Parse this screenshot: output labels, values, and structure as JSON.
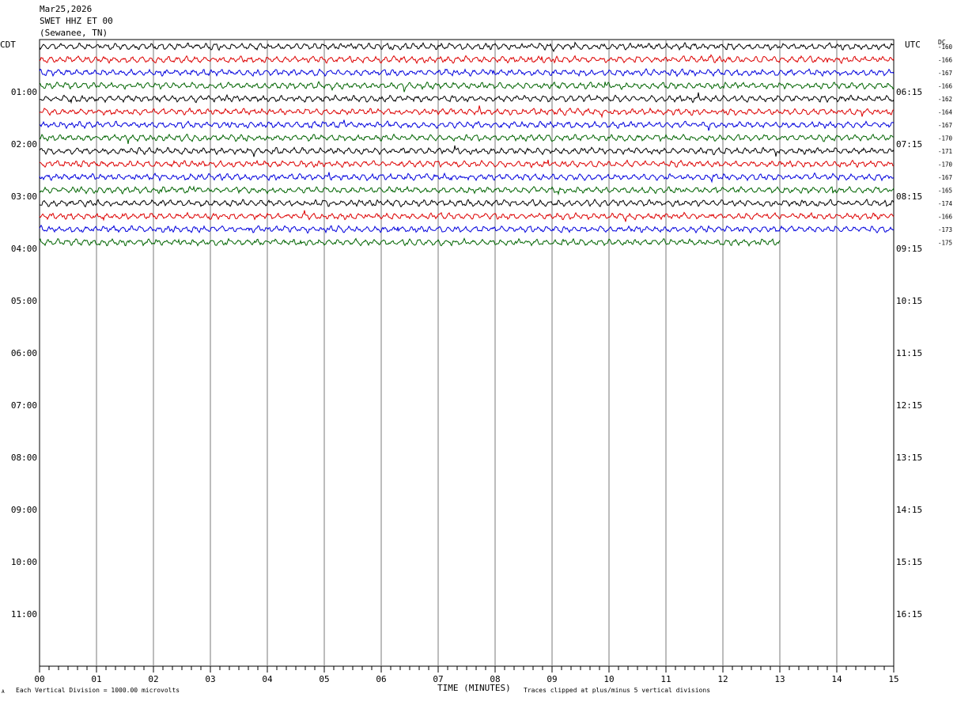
{
  "header": {
    "date": "Mar25,2026",
    "station": "SWET HHZ ET 00",
    "location": "(Sewanee, TN)"
  },
  "labels": {
    "left_tz": "CDT",
    "right_tz": "UTC",
    "dc_header": "DC"
  },
  "footer": {
    "xlabel": "TIME (MINUTES)",
    "scale_note": "Each Vertical Division = 1000.00 microvolts",
    "clip_note": "Traces clipped at plus/minus 5 vertical divisions",
    "corner_mark": "A"
  },
  "chart_data": {
    "type": "line",
    "title": "SWET HHZ ET 00",
    "xlabel": "TIME (MINUTES)",
    "x_range": [
      0,
      15
    ],
    "x_ticks": [
      "00",
      "01",
      "02",
      "03",
      "04",
      "05",
      "06",
      "07",
      "08",
      "09",
      "10",
      "11",
      "12",
      "13",
      "14",
      "15"
    ],
    "left_hour_labels": [
      "01:00",
      "02:00",
      "03:00",
      "04:00",
      "05:00",
      "06:00",
      "07:00",
      "08:00",
      "09:00",
      "10:00",
      "11:00"
    ],
    "right_hour_labels": [
      "06:15",
      "07:15",
      "08:15",
      "09:15",
      "10:15",
      "11:15",
      "12:15",
      "13:15",
      "14:15",
      "15:15",
      "16:15"
    ],
    "rows_total": 48,
    "trace_colors": [
      "#000000",
      "#dd0000",
      "#0000dd",
      "#006400"
    ],
    "traces": [
      {
        "row": 0,
        "color": "#000000",
        "dc": "-160",
        "minutes": 15
      },
      {
        "row": 1,
        "color": "#dd0000",
        "dc": "-166",
        "minutes": 15
      },
      {
        "row": 2,
        "color": "#0000dd",
        "dc": "-167",
        "minutes": 15
      },
      {
        "row": 3,
        "color": "#006400",
        "dc": "-166",
        "minutes": 15
      },
      {
        "row": 4,
        "color": "#000000",
        "dc": "-162",
        "minutes": 15
      },
      {
        "row": 5,
        "color": "#dd0000",
        "dc": "-164",
        "minutes": 15
      },
      {
        "row": 6,
        "color": "#0000dd",
        "dc": "-167",
        "minutes": 15
      },
      {
        "row": 7,
        "color": "#006400",
        "dc": "-170",
        "minutes": 15
      },
      {
        "row": 8,
        "color": "#000000",
        "dc": "-171",
        "minutes": 15
      },
      {
        "row": 9,
        "color": "#dd0000",
        "dc": "-170",
        "minutes": 15
      },
      {
        "row": 10,
        "color": "#0000dd",
        "dc": "-167",
        "minutes": 15
      },
      {
        "row": 11,
        "color": "#006400",
        "dc": "-165",
        "minutes": 15
      },
      {
        "row": 12,
        "color": "#000000",
        "dc": "-174",
        "minutes": 15
      },
      {
        "row": 13,
        "color": "#dd0000",
        "dc": "-166",
        "minutes": 15
      },
      {
        "row": 14,
        "color": "#0000dd",
        "dc": "-173",
        "minutes": 15
      },
      {
        "row": 15,
        "color": "#006400",
        "dc": "-175",
        "minutes": 13
      }
    ]
  }
}
